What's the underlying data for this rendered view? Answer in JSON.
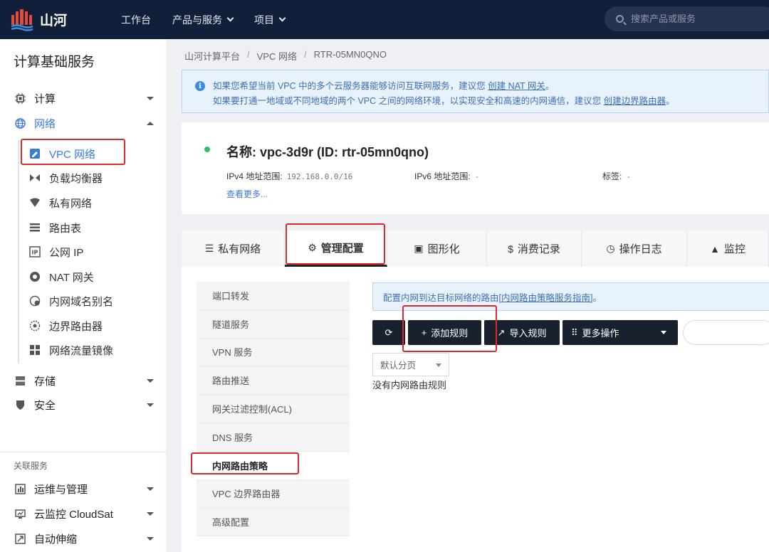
{
  "brand": {
    "name": "山河"
  },
  "topnav": {
    "items": [
      "工作台",
      "产品与服务",
      "项目"
    ]
  },
  "search": {
    "placeholder": "搜索产品或服务"
  },
  "sidebar": {
    "title": "计算基础服务",
    "groups": [
      {
        "label": "计算",
        "icon": "chip-icon"
      },
      {
        "label": "网络",
        "icon": "globe-icon"
      }
    ],
    "network_items": [
      {
        "label": "VPC 网络",
        "icon": "vpc-icon"
      },
      {
        "label": "负载均衡器",
        "icon": "load-balancer-icon"
      },
      {
        "label": "私有网络",
        "icon": "wifi-icon"
      },
      {
        "label": "路由表",
        "icon": "route-table-icon"
      },
      {
        "label": "公网 IP",
        "icon": "ip-icon"
      },
      {
        "label": "NAT 网关",
        "icon": "nat-icon"
      },
      {
        "label": "内网域名别名",
        "icon": "dns-alias-icon"
      },
      {
        "label": "边界路由器",
        "icon": "border-router-icon"
      },
      {
        "label": "网络流量镜像",
        "icon": "traffic-mirror-icon"
      }
    ],
    "other_groups": [
      {
        "label": "存储",
        "icon": "storage-icon"
      },
      {
        "label": "安全",
        "icon": "shield-icon"
      }
    ],
    "related_title": "关联服务",
    "related": [
      {
        "label": "运维与管理",
        "icon": "ops-icon"
      },
      {
        "label": "云监控 CloudSat",
        "icon": "monitor-icon"
      },
      {
        "label": "自动伸缩",
        "icon": "autoscale-icon"
      }
    ]
  },
  "breadcrumb": [
    "山河计算平台",
    "VPC 网络",
    "RTR-05MN0QNO"
  ],
  "alert": {
    "line1_text": "如果您希望当前 VPC 中的多个云服务器能够访问互联网服务，建议您 ",
    "line1_link": "创建 NAT 网关",
    "line1_end": "。",
    "line2_text": "如果要打通一地域或不同地域的两个 VPC 之间的网络环境，以实现安全和高速的内网通信，建议您 ",
    "line2_link": "创建边界路由器",
    "line2_end": "。"
  },
  "vpc": {
    "name": "名称: vpc-3d9r (ID: rtr-05mn0qno)",
    "ipv4_label": "IPv4 地址范围:",
    "ipv4_value": "192.168.0.0/16",
    "ipv6_label": "IPv6 地址范围:",
    "ipv6_value": "-",
    "tags_label": "标签:",
    "tags_value": "-",
    "see_more": "查看更多..."
  },
  "tabs": [
    {
      "label": "私有网络",
      "icon": "list-icon"
    },
    {
      "label": "管理配置",
      "icon": "gears-icon"
    },
    {
      "label": "图形化",
      "icon": "image-icon"
    },
    {
      "label": "消费记录",
      "icon": "dollar-icon"
    },
    {
      "label": "操作日志",
      "icon": "clock-icon"
    },
    {
      "label": "监控",
      "icon": "chart-icon"
    }
  ],
  "subnav": [
    "端口转发",
    "隧道服务",
    "VPN 服务",
    "路由推送",
    "网关过滤控制(ACL)",
    "DNS 服务",
    "内网路由策略",
    "VPC 边界路由器",
    "高级配置"
  ],
  "tip": {
    "text": "配置内网到达目标网络的路由[",
    "link": "内网路由策略服务指南",
    "end": "]。"
  },
  "toolbar": {
    "add": "添加规则",
    "import": "导入规则",
    "more": "更多操作"
  },
  "pagination": {
    "selected": "默认分页"
  },
  "empty": "没有内网路由规则",
  "colors": {
    "topbar": "#11203a",
    "accent": "#3b7ad9",
    "highlight": "#d92b2b",
    "status": "#2fbe6f"
  }
}
